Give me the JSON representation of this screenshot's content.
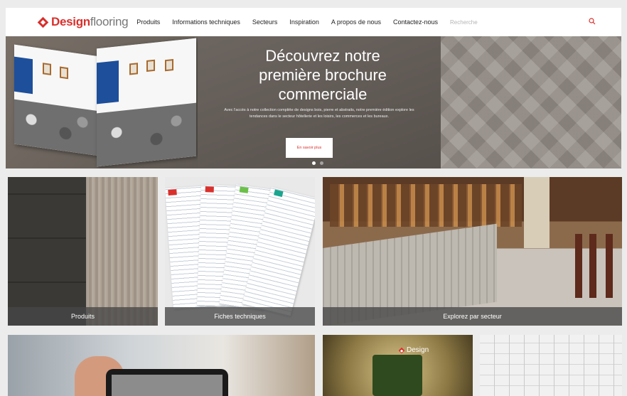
{
  "header": {
    "logo_part1": "Design",
    "logo_part2": "flooring",
    "nav": [
      "Produits",
      "Informations techniques",
      "Secteurs",
      "Inspiration",
      "A propos de nous",
      "Contactez-nous"
    ],
    "search_placeholder": "Recherche"
  },
  "hero": {
    "title_line1": "Découvrez notre",
    "title_line2": "première brochure",
    "title_line3": "commerciale",
    "text": "Avec l'accès à notre collection complète de designs bois, pierre et abstraits, notre première édition explore les tendances dans le secteur hôtellerie et les loisirs, les commerces et les bureaux.",
    "button": "En savoir plus"
  },
  "tiles": {
    "products": "Produits",
    "sheets": "Fiches techniques",
    "sector": "Explorez par secteur",
    "event_logo": "Design"
  },
  "colors": {
    "brand_red": "#d9302c"
  }
}
